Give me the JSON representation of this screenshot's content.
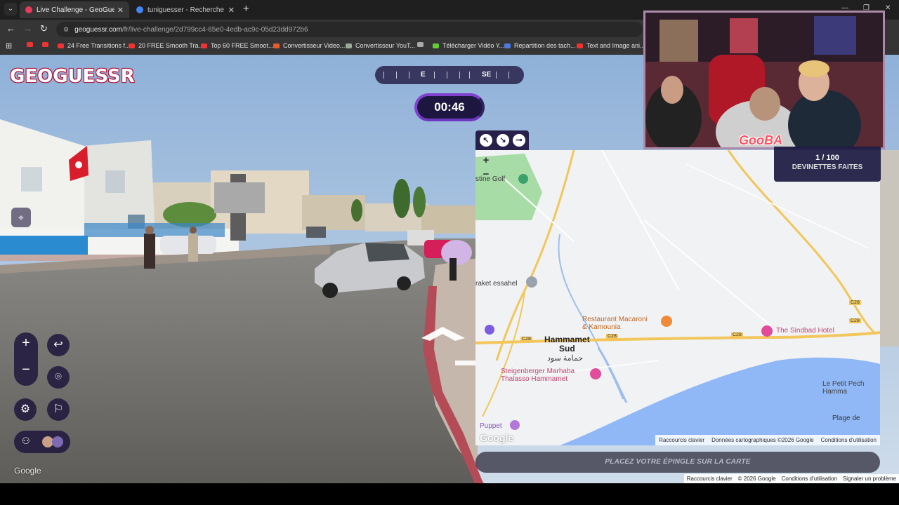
{
  "browser": {
    "tabs": [
      {
        "title": "Live Challenge - GeoGuessr",
        "active": true,
        "favicon_color": "#e83a5a"
      },
      {
        "title": "tuniguesser - Recherche Google",
        "active": false,
        "favicon_color": "#4285f4"
      }
    ],
    "new_tab_icon": "plus-icon",
    "url_host": "geoguessr.com",
    "url_path": "/fr/live-challenge/2d799cc4-65e0-4edb-ac9c-05d23dd972b6",
    "bookmarks": [
      {
        "label": "",
        "icon": "youtube-icon",
        "color": "#e33"
      },
      {
        "label": "",
        "icon": "youtube-icon",
        "color": "#e33"
      },
      {
        "label": "24 Free Transitions f...",
        "icon": "youtube-icon",
        "color": "#e33"
      },
      {
        "label": "20 FREE Smooth Tra...",
        "icon": "youtube-icon",
        "color": "#e33"
      },
      {
        "label": "Top 60 FREE Smoot...",
        "icon": "youtube-icon",
        "color": "#e33"
      },
      {
        "label": "Convertisseur Video...",
        "icon": "z-icon",
        "color": "#e85a2a"
      },
      {
        "label": "Convertisseur YouT...",
        "icon": "bird-icon",
        "color": "#9a9"
      },
      {
        "label": "",
        "icon": "globe-icon",
        "color": "#aaa"
      },
      {
        "label": "Télécharger Vidéo Y...",
        "icon": "download-icon",
        "color": "#6c3"
      },
      {
        "label": "Repartition des tach...",
        "icon": "doc-icon",
        "color": "#4a7be0"
      },
      {
        "label": "Text and Image ani...",
        "icon": "youtube-icon",
        "color": "#e33"
      }
    ]
  },
  "game": {
    "logo": "GEOGUESSR",
    "compass": {
      "labels": [
        "E",
        "SE"
      ]
    },
    "timer": "00:46",
    "guess_button": "PLACEZ VOTRE ÉPINGLE SUR LA CARTE",
    "streetview_credit": "Google",
    "footer_links": [
      "Raccourcis clavier",
      "© 2026 Google",
      "Conditions d'utilisation",
      "Signaler un problème"
    ]
  },
  "map": {
    "labels": {
      "golf": "stine Golf",
      "essahel": "raket essahel",
      "restaurant": "Restaurant Macaroni\n& Kamounia",
      "hammamet_sud": "Hammamet\nSud",
      "hammamet_ar": "حمامة سود",
      "sindbad": "The Sindbad Hotel",
      "steigenberger": "Steigenberger Marhaba\nThalasso Hammamet",
      "puppet": "Puppet",
      "petit_pech": "Le Petit Pech\nHamma",
      "plage": "Plage de",
      "road1": "C28",
      "road2": "C28",
      "road3": "C28",
      "road4": "C28",
      "road5": "C28",
      "zoom_in": "+",
      "zoom_out": "−"
    },
    "google_logo": "Google",
    "attribution": [
      "Raccourcis clavier",
      "Données cartographiques ©2026 Google",
      "Conditions d'utilisation"
    ],
    "tools": [
      "arrow-up-left-icon",
      "arrow-down-right-icon",
      "pin-icon"
    ]
  },
  "webcam": {
    "streamer_tag": "GooBA"
  },
  "counter": {
    "count": "1 / 100",
    "label": "DEVINETTES FAITES"
  }
}
